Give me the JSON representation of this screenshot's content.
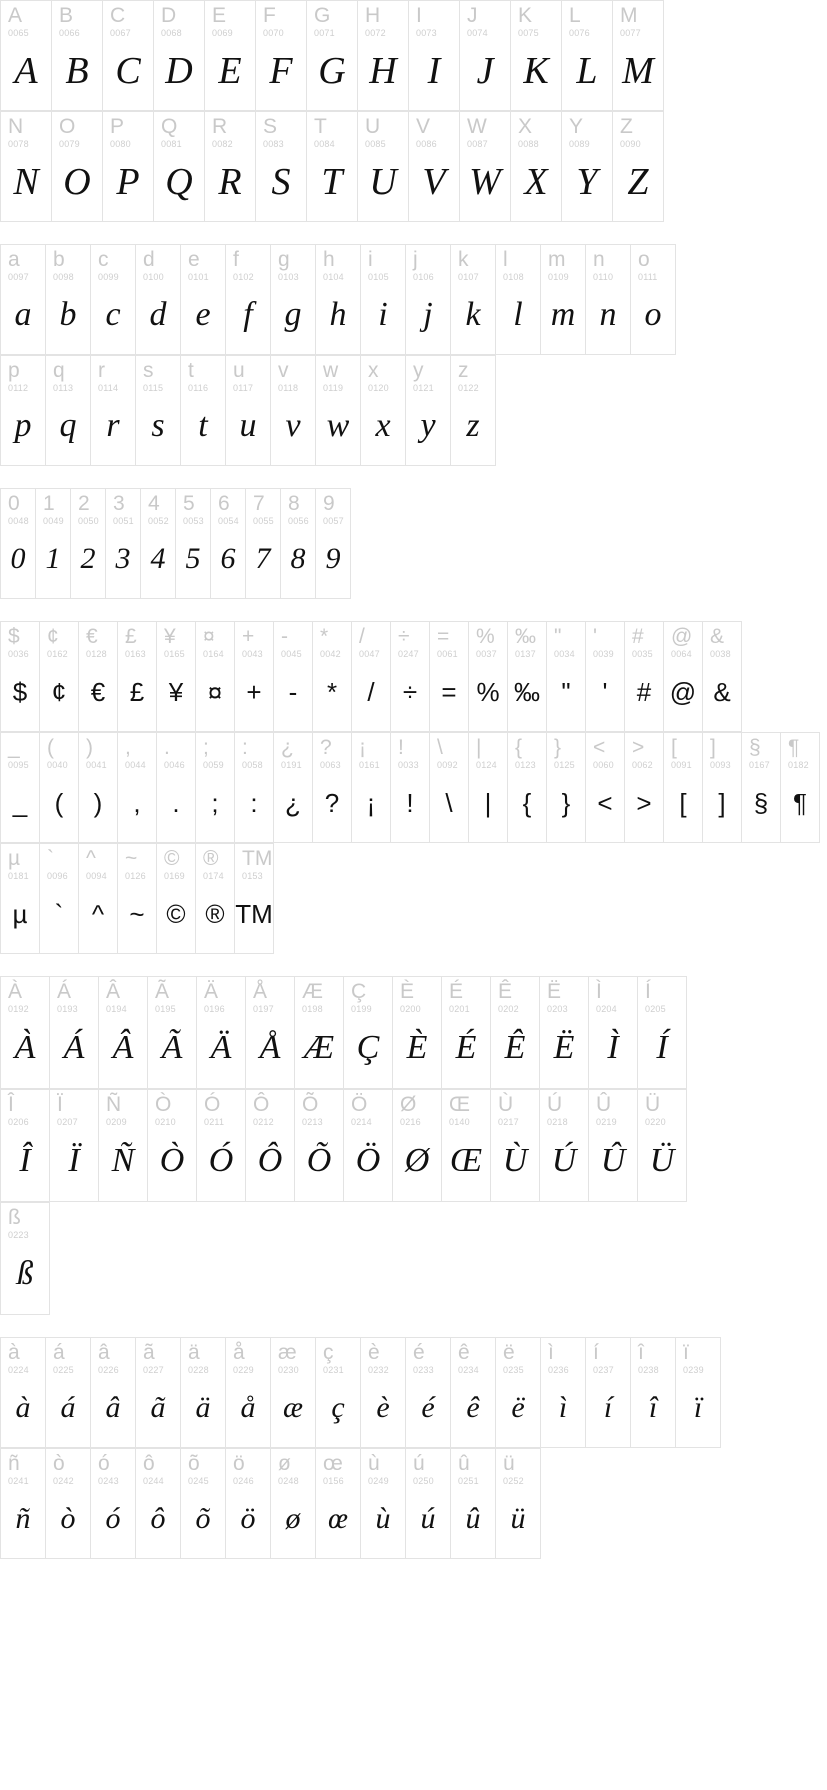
{
  "view": {
    "name": "font-character-map",
    "background": "#ffffff",
    "grid_line_color": "#e3e3e3",
    "label_color": "#c9c9c9",
    "code_color": "#cfcfcf",
    "glyph_color": "#111111"
  },
  "blocks": [
    {
      "id": "uppercase",
      "size": "size-upper",
      "rows": [
        [
          {
            "char": "A",
            "code": "0065"
          },
          {
            "char": "B",
            "code": "0066"
          },
          {
            "char": "C",
            "code": "0067"
          },
          {
            "char": "D",
            "code": "0068"
          },
          {
            "char": "E",
            "code": "0069"
          },
          {
            "char": "F",
            "code": "0070"
          },
          {
            "char": "G",
            "code": "0071"
          },
          {
            "char": "H",
            "code": "0072"
          },
          {
            "char": "I",
            "code": "0073"
          },
          {
            "char": "J",
            "code": "0074"
          },
          {
            "char": "K",
            "code": "0075"
          },
          {
            "char": "L",
            "code": "0076"
          },
          {
            "char": "M",
            "code": "0077"
          }
        ],
        [
          {
            "char": "N",
            "code": "0078"
          },
          {
            "char": "O",
            "code": "0079"
          },
          {
            "char": "P",
            "code": "0080"
          },
          {
            "char": "Q",
            "code": "0081"
          },
          {
            "char": "R",
            "code": "0082"
          },
          {
            "char": "S",
            "code": "0083"
          },
          {
            "char": "T",
            "code": "0084"
          },
          {
            "char": "U",
            "code": "0085"
          },
          {
            "char": "V",
            "code": "0086"
          },
          {
            "char": "W",
            "code": "0087"
          },
          {
            "char": "X",
            "code": "0088"
          },
          {
            "char": "Y",
            "code": "0089"
          },
          {
            "char": "Z",
            "code": "0090"
          }
        ]
      ]
    },
    {
      "id": "lowercase",
      "size": "size-lower",
      "rows": [
        [
          {
            "char": "a",
            "code": "0097"
          },
          {
            "char": "b",
            "code": "0098"
          },
          {
            "char": "c",
            "code": "0099"
          },
          {
            "char": "d",
            "code": "0100"
          },
          {
            "char": "e",
            "code": "0101"
          },
          {
            "char": "f",
            "code": "0102"
          },
          {
            "char": "g",
            "code": "0103"
          },
          {
            "char": "h",
            "code": "0104"
          },
          {
            "char": "i",
            "code": "0105"
          },
          {
            "char": "j",
            "code": "0106"
          },
          {
            "char": "k",
            "code": "0107"
          },
          {
            "char": "l",
            "code": "0108"
          },
          {
            "char": "m",
            "code": "0109"
          },
          {
            "char": "n",
            "code": "0110"
          },
          {
            "char": "o",
            "code": "0111"
          }
        ],
        [
          {
            "char": "p",
            "code": "0112"
          },
          {
            "char": "q",
            "code": "0113"
          },
          {
            "char": "r",
            "code": "0114"
          },
          {
            "char": "s",
            "code": "0115"
          },
          {
            "char": "t",
            "code": "0116"
          },
          {
            "char": "u",
            "code": "0117"
          },
          {
            "char": "v",
            "code": "0118"
          },
          {
            "char": "w",
            "code": "0119"
          },
          {
            "char": "x",
            "code": "0120"
          },
          {
            "char": "y",
            "code": "0121"
          },
          {
            "char": "z",
            "code": "0122"
          }
        ]
      ]
    },
    {
      "id": "digits",
      "size": "size-digit",
      "rows": [
        [
          {
            "char": "0",
            "code": "0048"
          },
          {
            "char": "1",
            "code": "0049"
          },
          {
            "char": "2",
            "code": "0050"
          },
          {
            "char": "3",
            "code": "0051"
          },
          {
            "char": "4",
            "code": "0052"
          },
          {
            "char": "5",
            "code": "0053"
          },
          {
            "char": "6",
            "code": "0054"
          },
          {
            "char": "7",
            "code": "0055"
          },
          {
            "char": "8",
            "code": "0056"
          },
          {
            "char": "9",
            "code": "0057"
          }
        ]
      ]
    },
    {
      "id": "symbols",
      "size": "size-sym",
      "rows": [
        [
          {
            "char": "$",
            "code": "0036"
          },
          {
            "char": "¢",
            "code": "0162"
          },
          {
            "char": "€",
            "code": "0128"
          },
          {
            "char": "£",
            "code": "0163"
          },
          {
            "char": "¥",
            "code": "0165"
          },
          {
            "char": "¤",
            "code": "0164"
          },
          {
            "char": "+",
            "code": "0043"
          },
          {
            "char": "-",
            "code": "0045"
          },
          {
            "char": "*",
            "code": "0042"
          },
          {
            "char": "/",
            "code": "0047"
          },
          {
            "char": "÷",
            "code": "0247"
          },
          {
            "char": "=",
            "code": "0061"
          },
          {
            "char": "%",
            "code": "0037"
          },
          {
            "char": "‰",
            "code": "0137"
          },
          {
            "char": "\"",
            "code": "0034"
          },
          {
            "char": "'",
            "code": "0039"
          },
          {
            "char": "#",
            "code": "0035"
          },
          {
            "char": "@",
            "code": "0064"
          },
          {
            "char": "&",
            "code": "0038"
          }
        ],
        [
          {
            "char": "_",
            "code": "0095"
          },
          {
            "char": "(",
            "code": "0040"
          },
          {
            "char": ")",
            "code": "0041"
          },
          {
            "char": ",",
            "code": "0044"
          },
          {
            "char": ".",
            "code": "0046"
          },
          {
            "char": ";",
            "code": "0059"
          },
          {
            "char": ":",
            "code": "0058"
          },
          {
            "char": "¿",
            "code": "0191"
          },
          {
            "char": "?",
            "code": "0063"
          },
          {
            "char": "¡",
            "code": "0161"
          },
          {
            "char": "!",
            "code": "0033"
          },
          {
            "char": "\\",
            "code": "0092"
          },
          {
            "char": "|",
            "code": "0124"
          },
          {
            "char": "{",
            "code": "0123"
          },
          {
            "char": "}",
            "code": "0125"
          },
          {
            "char": "<",
            "code": "0060"
          },
          {
            "char": ">",
            "code": "0062"
          },
          {
            "char": "[",
            "code": "0091"
          },
          {
            "char": "]",
            "code": "0093"
          },
          {
            "char": "§",
            "code": "0167"
          },
          {
            "char": "¶",
            "code": "0182"
          }
        ],
        [
          {
            "char": "µ",
            "code": "0181"
          },
          {
            "char": "`",
            "code": "0096"
          },
          {
            "char": "^",
            "code": "0094"
          },
          {
            "char": "~",
            "code": "0126"
          },
          {
            "char": "©",
            "code": "0169"
          },
          {
            "char": "®",
            "code": "0174"
          },
          {
            "char": "TM",
            "code": "0153"
          }
        ]
      ]
    },
    {
      "id": "uppercase-accented",
      "size": "size-ucacc",
      "rows": [
        [
          {
            "char": "À",
            "code": "0192"
          },
          {
            "char": "Á",
            "code": "0193"
          },
          {
            "char": "Â",
            "code": "0194"
          },
          {
            "char": "Ã",
            "code": "0195"
          },
          {
            "char": "Ä",
            "code": "0196"
          },
          {
            "char": "Å",
            "code": "0197"
          },
          {
            "char": "Æ",
            "code": "0198"
          },
          {
            "char": "Ç",
            "code": "0199"
          },
          {
            "char": "È",
            "code": "0200"
          },
          {
            "char": "É",
            "code": "0201"
          },
          {
            "char": "Ê",
            "code": "0202"
          },
          {
            "char": "Ë",
            "code": "0203"
          },
          {
            "char": "Ì",
            "code": "0204"
          },
          {
            "char": "Í",
            "code": "0205"
          }
        ],
        [
          {
            "char": "Î",
            "code": "0206"
          },
          {
            "char": "Ï",
            "code": "0207"
          },
          {
            "char": "Ñ",
            "code": "0209"
          },
          {
            "char": "Ò",
            "code": "0210"
          },
          {
            "char": "Ó",
            "code": "0211"
          },
          {
            "char": "Ô",
            "code": "0212"
          },
          {
            "char": "Õ",
            "code": "0213"
          },
          {
            "char": "Ö",
            "code": "0214"
          },
          {
            "char": "Ø",
            "code": "0216"
          },
          {
            "char": "Œ",
            "code": "0140"
          },
          {
            "char": "Ù",
            "code": "0217"
          },
          {
            "char": "Ú",
            "code": "0218"
          },
          {
            "char": "Û",
            "code": "0219"
          },
          {
            "char": "Ü",
            "code": "0220"
          }
        ],
        [
          {
            "char": "ß",
            "code": "0223"
          }
        ]
      ]
    },
    {
      "id": "lowercase-accented",
      "size": "size-lcacc",
      "rows": [
        [
          {
            "char": "à",
            "code": "0224"
          },
          {
            "char": "á",
            "code": "0225"
          },
          {
            "char": "â",
            "code": "0226"
          },
          {
            "char": "ã",
            "code": "0227"
          },
          {
            "char": "ä",
            "code": "0228"
          },
          {
            "char": "å",
            "code": "0229"
          },
          {
            "char": "æ",
            "code": "0230"
          },
          {
            "char": "ç",
            "code": "0231"
          },
          {
            "char": "è",
            "code": "0232"
          },
          {
            "char": "é",
            "code": "0233"
          },
          {
            "char": "ê",
            "code": "0234"
          },
          {
            "char": "ë",
            "code": "0235"
          },
          {
            "char": "ì",
            "code": "0236"
          },
          {
            "char": "í",
            "code": "0237"
          },
          {
            "char": "î",
            "code": "0238"
          },
          {
            "char": "ï",
            "code": "0239"
          }
        ],
        [
          {
            "char": "ñ",
            "code": "0241"
          },
          {
            "char": "ò",
            "code": "0242"
          },
          {
            "char": "ó",
            "code": "0243"
          },
          {
            "char": "ô",
            "code": "0244"
          },
          {
            "char": "õ",
            "code": "0245"
          },
          {
            "char": "ö",
            "code": "0246"
          },
          {
            "char": "ø",
            "code": "0248"
          },
          {
            "char": "œ",
            "code": "0156"
          },
          {
            "char": "ù",
            "code": "0249"
          },
          {
            "char": "ú",
            "code": "0250"
          },
          {
            "char": "û",
            "code": "0251"
          },
          {
            "char": "ü",
            "code": "0252"
          }
        ]
      ]
    }
  ]
}
